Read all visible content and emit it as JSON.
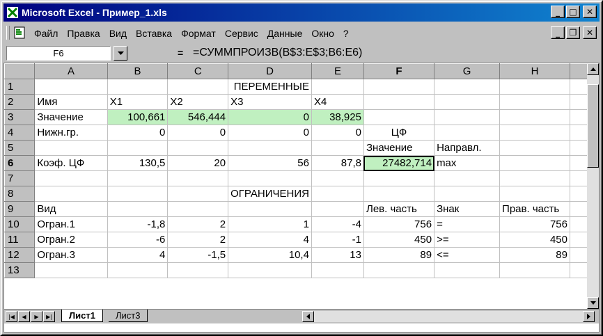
{
  "window": {
    "title": "Microsoft Excel - Пример_1.xls",
    "buttons": [
      "_",
      "□",
      "✕"
    ]
  },
  "menu": {
    "items": [
      "Файл",
      "Правка",
      "Вид",
      "Вставка",
      "Формат",
      "Сервис",
      "Данные",
      "Окно",
      "?"
    ],
    "mdi_buttons": [
      "_",
      "❐",
      "✕"
    ]
  },
  "formula_bar": {
    "name_box": "F6",
    "equals": "=",
    "formula": "=СУММПРОИЗВ(B$3:E$3;B6:E6)"
  },
  "columns": [
    "A",
    "B",
    "C",
    "D",
    "E",
    "F",
    "G",
    "H"
  ],
  "rows": [
    {
      "n": "1",
      "cells": [
        "",
        "",
        "",
        "ПЕРЕМЕННЫЕ",
        "",
        "",
        "",
        ""
      ]
    },
    {
      "n": "2",
      "cells": [
        "Имя",
        "X1",
        "X2",
        "X3",
        "X4",
        "",
        "",
        ""
      ]
    },
    {
      "n": "3",
      "cells": [
        "Значение",
        "100,661",
        "546,444",
        "0",
        "38,925",
        "",
        "",
        ""
      ]
    },
    {
      "n": "4",
      "cells": [
        "Нижн.гр.",
        "0",
        "0",
        "0",
        "0",
        "ЦФ",
        "",
        ""
      ]
    },
    {
      "n": "5",
      "cells": [
        "",
        "",
        "",
        "",
        "",
        "Значение",
        "Направл.",
        ""
      ]
    },
    {
      "n": "6",
      "cells": [
        "Коэф. ЦФ",
        "130,5",
        "20",
        "56",
        "87,8",
        "27482,714",
        "max",
        ""
      ]
    },
    {
      "n": "7",
      "cells": [
        "",
        "",
        "",
        "",
        "",
        "",
        "",
        ""
      ]
    },
    {
      "n": "8",
      "cells": [
        "",
        "",
        "",
        "ОГРАНИЧЕНИЯ",
        "",
        "",
        "",
        ""
      ]
    },
    {
      "n": "9",
      "cells": [
        "Вид",
        "",
        "",
        "",
        "",
        "Лев. часть",
        "Знак",
        "Прав. часть"
      ]
    },
    {
      "n": "10",
      "cells": [
        "Огран.1",
        "-1,8",
        "2",
        "1",
        "-4",
        "756",
        "=",
        "756"
      ]
    },
    {
      "n": "11",
      "cells": [
        "Огран.2",
        "-6",
        "2",
        "4",
        "-1",
        "450",
        ">=",
        "450"
      ]
    },
    {
      "n": "12",
      "cells": [
        "Огран.3",
        "4",
        "-1,5",
        "10,4",
        "13",
        "89",
        "<=",
        "89"
      ]
    },
    {
      "n": "13",
      "cells": [
        "",
        "",
        "",
        "",
        "",
        "",
        "",
        ""
      ]
    }
  ],
  "sheets": {
    "active": "Лист1",
    "other": "Лист3"
  },
  "colors": {
    "title_start": "#000080",
    "title_end": "#1084d0",
    "input_cell": "#c0f0c0"
  }
}
